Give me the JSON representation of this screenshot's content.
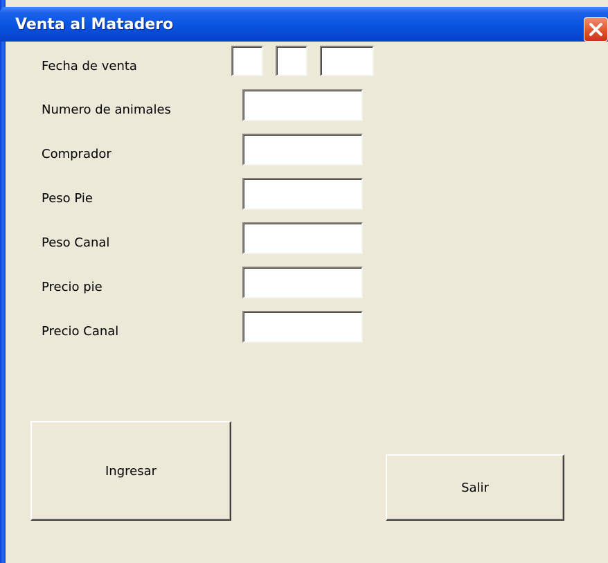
{
  "window": {
    "title": "Venta al Matadero"
  },
  "form": {
    "fecha_label": "Fecha de venta",
    "numero_label": "Numero de animales",
    "comprador_label": "Comprador",
    "peso_pie_label": "Peso Pie",
    "peso_canal_label": "Peso Canal",
    "precio_pie_label": "Precio pie",
    "precio_canal_label": "Precio Canal"
  },
  "buttons": {
    "ingresar": "Ingresar",
    "salir": "Salir"
  },
  "colors": {
    "titlebar": "#0a55e3",
    "face": "#ece9d8",
    "close": "#e0502a"
  }
}
